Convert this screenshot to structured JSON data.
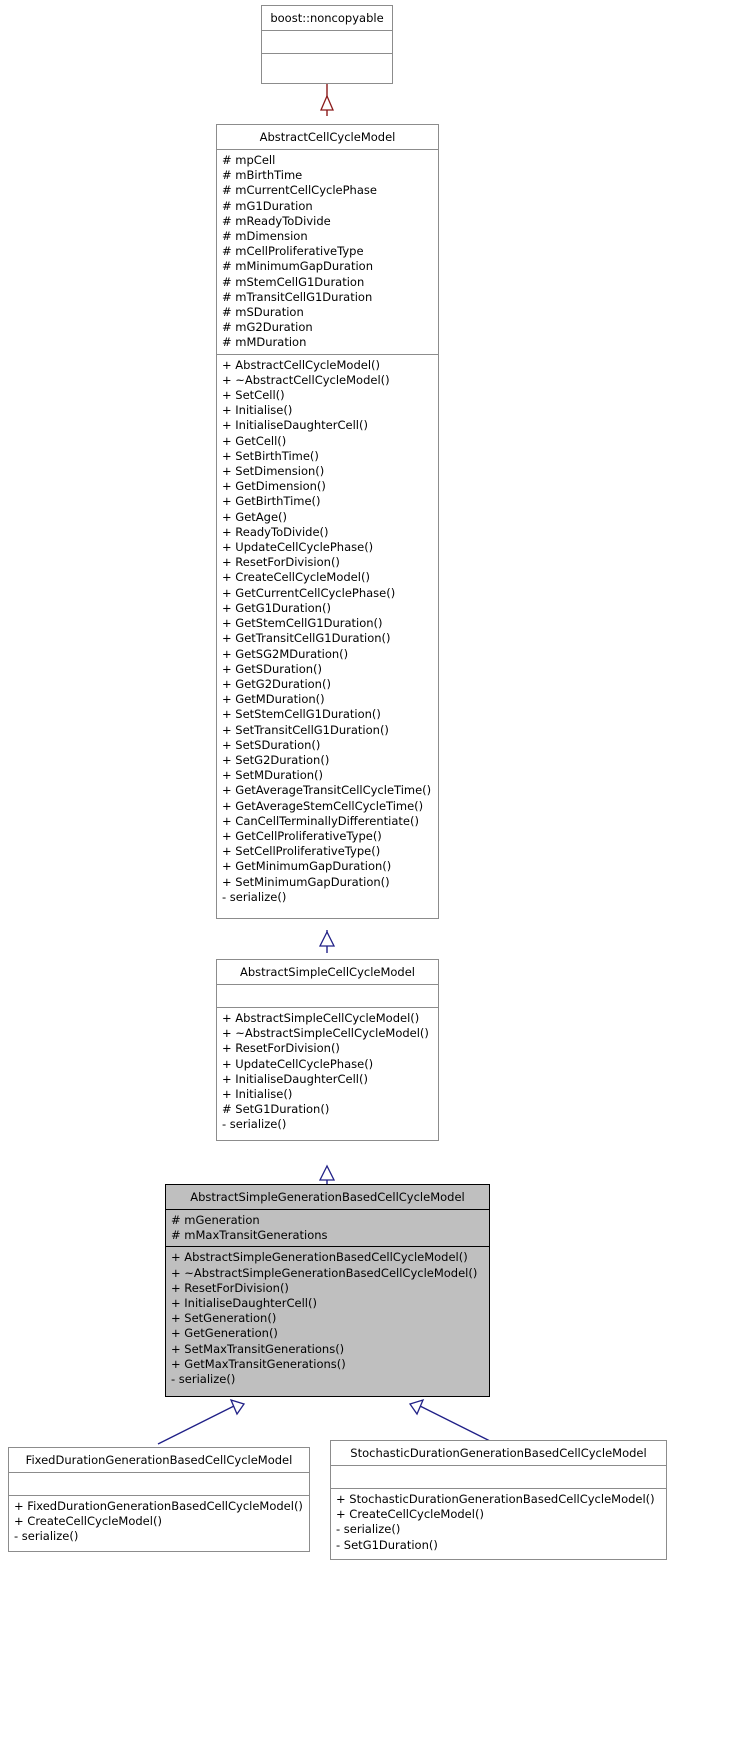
{
  "diagram": {
    "type": "uml-class-inheritance",
    "title": "AbstractSimpleGenerationBasedCellCycleModel inheritance diagram",
    "edge_color": "#222288",
    "inherit_edge_color_top": "#8b1a1a",
    "highlight_fill": "#bfbfbf"
  },
  "classes": [
    {
      "id": "boost_noncopyable",
      "name": "boost::noncopyable",
      "attributes": [],
      "methods": []
    },
    {
      "id": "abstract_cell_cycle_model",
      "name": "AbstractCellCycleModel",
      "attributes": [
        "# mpCell",
        "# mBirthTime",
        "# mCurrentCellCyclePhase",
        "# mG1Duration",
        "# mReadyToDivide",
        "# mDimension",
        "# mCellProliferativeType",
        "# mMinimumGapDuration",
        "# mStemCellG1Duration",
        "# mTransitCellG1Duration",
        "# mSDuration",
        "# mG2Duration",
        "# mMDuration"
      ],
      "methods": [
        "+ AbstractCellCycleModel()",
        "+ ~AbstractCellCycleModel()",
        "+ SetCell()",
        "+ Initialise()",
        "+ InitialiseDaughterCell()",
        "+ GetCell()",
        "+ SetBirthTime()",
        "+ SetDimension()",
        "+ GetDimension()",
        "+ GetBirthTime()",
        "+ GetAge()",
        "+ ReadyToDivide()",
        "+ UpdateCellCyclePhase()",
        "+ ResetForDivision()",
        "+ CreateCellCycleModel()",
        "+ GetCurrentCellCyclePhase()",
        "+ GetG1Duration()",
        "+ GetStemCellG1Duration()",
        "+ GetTransitCellG1Duration()",
        "+ GetSG2MDuration()",
        "+ GetSDuration()",
        "+ GetG2Duration()",
        "+ GetMDuration()",
        "+ SetStemCellG1Duration()",
        "+ SetTransitCellG1Duration()",
        "+ SetSDuration()",
        "+ SetG2Duration()",
        "+ SetMDuration()",
        "+ GetAverageTransitCellCycleTime()",
        "+ GetAverageStemCellCycleTime()",
        "+ CanCellTerminallyDifferentiate()",
        "+ GetCellProliferativeType()",
        "+ SetCellProliferativeType()",
        "+ GetMinimumGapDuration()",
        "+ SetMinimumGapDuration()",
        "- serialize()"
      ]
    },
    {
      "id": "abstract_simple_cell_cycle_model",
      "name": "AbstractSimpleCellCycleModel",
      "attributes": [],
      "methods": [
        "+ AbstractSimpleCellCycleModel()",
        "+ ~AbstractSimpleCellCycleModel()",
        "+ ResetForDivision()",
        "+ UpdateCellCyclePhase()",
        "+ InitialiseDaughterCell()",
        "+ Initialise()",
        "# SetG1Duration()",
        "- serialize()"
      ]
    },
    {
      "id": "abstract_simple_generation_based_cell_cycle_model",
      "name": "AbstractSimpleGenerationBasedCellCycleModel",
      "highlighted": true,
      "attributes": [
        "# mGeneration",
        "# mMaxTransitGenerations"
      ],
      "methods": [
        "+ AbstractSimpleGenerationBasedCellCycleModel()",
        "+ ~AbstractSimpleGenerationBasedCellCycleModel()",
        "+ ResetForDivision()",
        "+ InitialiseDaughterCell()",
        "+ SetGeneration()",
        "+ GetGeneration()",
        "+ SetMaxTransitGenerations()",
        "+ GetMaxTransitGenerations()",
        "- serialize()"
      ]
    },
    {
      "id": "fixed_duration_generation_based_cell_cycle_model",
      "name": "FixedDurationGenerationBasedCellCycleModel",
      "attributes": [],
      "methods": [
        "+ FixedDurationGenerationBasedCellCycleModel()",
        "+ CreateCellCycleModel()",
        "- serialize()"
      ]
    },
    {
      "id": "stochastic_duration_generation_based_cell_cycle_model",
      "name": "StochasticDurationGenerationBasedCellCycleModel",
      "attributes": [],
      "methods": [
        "+ StochasticDurationGenerationBasedCellCycleModel()",
        "+ CreateCellCycleModel()",
        "- serialize()",
        "- SetG1Duration()"
      ]
    }
  ]
}
